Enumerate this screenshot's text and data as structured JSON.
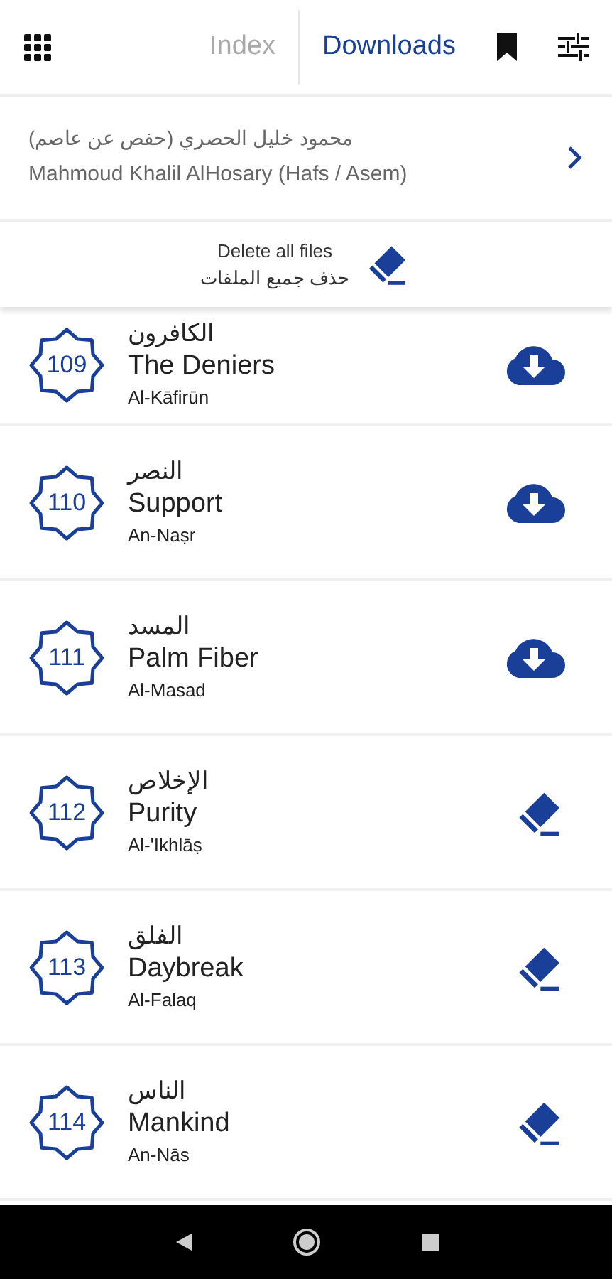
{
  "tabs": [
    {
      "label": "Index",
      "selected": false
    },
    {
      "label": "Downloads",
      "selected": true
    }
  ],
  "reciter": {
    "name_arabic": "محمود خليل الحصري (حفص عن عاصم)",
    "name": "Mahmoud Khalil AlHosary (Hafs / Asem)"
  },
  "delete_all": {
    "label": "Delete all files",
    "label_arabic": "حذف جميع الملفات"
  },
  "surahs": [
    {
      "number": "109",
      "arabic": "الكافرون",
      "title": "The Deniers",
      "transliteration": "Al-Kāfirūn",
      "downloaded": false
    },
    {
      "number": "110",
      "arabic": "النصر",
      "title": "Support",
      "transliteration": "An-Naṣr",
      "downloaded": false
    },
    {
      "number": "111",
      "arabic": "المسد",
      "title": "Palm Fiber",
      "transliteration": "Al-Masad",
      "downloaded": false
    },
    {
      "number": "112",
      "arabic": "الإخلاص",
      "title": "Purity",
      "transliteration": "Al-'Ikhlāṣ",
      "downloaded": true
    },
    {
      "number": "113",
      "arabic": "الفلق",
      "title": "Daybreak",
      "transliteration": "Al-Falaq",
      "downloaded": true
    },
    {
      "number": "114",
      "arabic": "الناس",
      "title": "Mankind",
      "transliteration": "An-Nās",
      "downloaded": true
    }
  ]
}
